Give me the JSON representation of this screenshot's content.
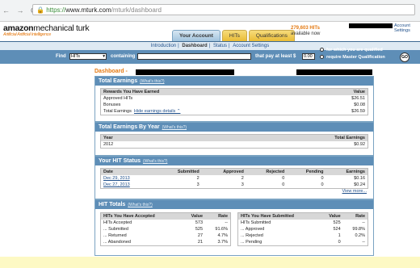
{
  "browser": {
    "nav": "← → C",
    "lock": "🔒",
    "url_scheme": "https://",
    "url_host": "www.mturk.com",
    "url_path": "/mturk/dashboard"
  },
  "brand": {
    "name_bold": "amazon",
    "name_rest": "mechanical turk",
    "tagline": "Artificial Artificial Intelligence"
  },
  "tabs": [
    "Your Account",
    "HITs",
    "Qualifications"
  ],
  "hits_available": {
    "count": "279,603 HITs",
    "label": "available now"
  },
  "account_link": "Account Settings",
  "subnav": [
    "Introduction",
    "Dashboard",
    "Status",
    "Account Settings"
  ],
  "search": {
    "find_label": "Find",
    "find_value": "HITs",
    "containing_label": "containing",
    "pay_label": "that pay at least $",
    "pay_value": "0.00",
    "opt1": "for which you are qualified",
    "opt2": "require Master Qualification",
    "go": "GO"
  },
  "dashboard_title": "Dashboard -",
  "whats_this": "(What's this?)",
  "total_earnings": {
    "title": "Total Earnings",
    "col1": "Rewards You Have Earned",
    "col2": "Value",
    "rows": [
      [
        "Approved HITs",
        "$26.51"
      ],
      [
        "Bonuses",
        "$0.08"
      ],
      [
        "Total Earnings",
        "$26.59"
      ]
    ],
    "hide_link": "Hide earnings details ⌃"
  },
  "by_year": {
    "title": "Total Earnings By Year",
    "col1": "Year",
    "col2": "Total Earnings",
    "rows": [
      [
        "2012",
        "$0.92"
      ]
    ]
  },
  "hit_status": {
    "title": "Your HIT Status",
    "cols": [
      "Date",
      "Submitted",
      "Approved",
      "Rejected",
      "Pending",
      "Earnings"
    ],
    "rows": [
      [
        "Dec 29, 2013",
        "2",
        "2",
        "0",
        "0",
        "$0.16"
      ],
      [
        "Dec 27, 2013",
        "3",
        "3",
        "0",
        "0",
        "$0.24"
      ]
    ],
    "more": "View more..."
  },
  "hit_totals": {
    "title": "HIT Totals",
    "accepted": {
      "cols": [
        "HITs You Have Accepted",
        "Value",
        "Rate"
      ],
      "rows": [
        [
          "HITs Accepted",
          "573",
          "--"
        ],
        [
          "... Submitted",
          "525",
          "91.6%"
        ],
        [
          "... Returned",
          "27",
          "4.7%"
        ],
        [
          "... Abandoned",
          "21",
          "3.7%"
        ]
      ]
    },
    "submitted": {
      "cols": [
        "HITs You Have Submitted",
        "Value",
        "Rate"
      ],
      "rows": [
        [
          "HITs Submitted",
          "525",
          "--"
        ],
        [
          "... Approved",
          "524",
          "99.8%"
        ],
        [
          "... Rejected",
          "1",
          "0.2%"
        ],
        [
          "... Pending",
          "0",
          "--"
        ]
      ]
    }
  }
}
